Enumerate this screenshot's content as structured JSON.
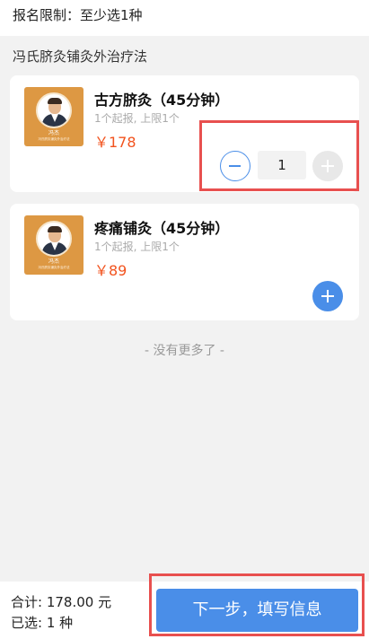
{
  "header": {
    "limit_text": "报名限制：至少选1种"
  },
  "section": {
    "title": "冯氏脐灸铺灸外治疗法"
  },
  "items": [
    {
      "name": "古方脐灸（45分钟）",
      "sub": "1个起报, 上限1个",
      "price": "￥178",
      "thumb_name": "冯杰",
      "thumb_sub": "冯氏脐灸铺灸外治疗法",
      "quantity": "1"
    },
    {
      "name": "疼痛铺灸（45分钟）",
      "sub": "1个起报, 上限1个",
      "price": "￥89",
      "thumb_name": "冯杰",
      "thumb_sub": "冯氏脐灸铺灸外治疗法"
    }
  ],
  "list_end": "- 没有更多了 -",
  "footer": {
    "total": "合计: 178.00 元",
    "selected": "已选: 1 种",
    "next_label": "下一步，填写信息"
  },
  "colors": {
    "accent": "#4a8ee8",
    "price": "#f2531e",
    "highlight": "#e8504f",
    "thumb_bg": "#dd9843"
  }
}
